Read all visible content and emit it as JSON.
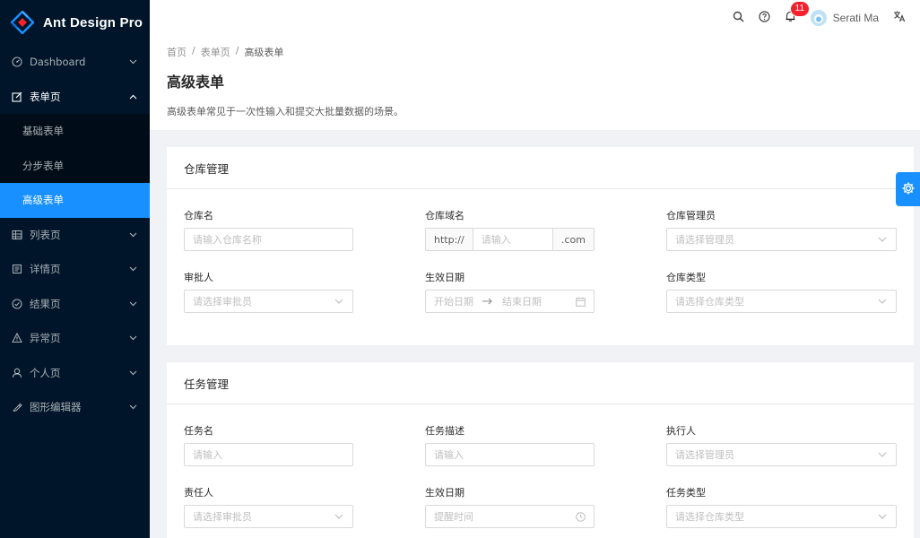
{
  "app": {
    "name": "Ant Design Pro"
  },
  "sidebar": {
    "items": [
      {
        "label": "Dashboard",
        "icon": "dashboard-icon"
      },
      {
        "label": "表单页",
        "icon": "form-icon",
        "open": true,
        "children": [
          {
            "label": "基础表单"
          },
          {
            "label": "分步表单"
          },
          {
            "label": "高级表单",
            "selected": true
          }
        ]
      },
      {
        "label": "列表页",
        "icon": "table-icon"
      },
      {
        "label": "详情页",
        "icon": "profile-icon"
      },
      {
        "label": "结果页",
        "icon": "check-circle-icon"
      },
      {
        "label": "异常页",
        "icon": "warning-icon"
      },
      {
        "label": "个人页",
        "icon": "user-icon"
      },
      {
        "label": "图形编辑器",
        "icon": "highlight-icon"
      }
    ]
  },
  "header": {
    "notification_count": "11",
    "user_name": "Serati Ma"
  },
  "page": {
    "breadcrumb": [
      "首页",
      "表单页",
      "高级表单"
    ],
    "title": "高级表单",
    "description": "高级表单常见于一次性输入和提交大批量数据的场景。"
  },
  "warehouse_card": {
    "title": "仓库管理",
    "name": {
      "label": "仓库名",
      "placeholder": "请输入仓库名称"
    },
    "domain": {
      "label": "仓库域名",
      "prefix": "http://",
      "placeholder": "请输入",
      "suffix": ".com"
    },
    "admin": {
      "label": "仓库管理员",
      "placeholder": "请选择管理员"
    },
    "approver": {
      "label": "审批人",
      "placeholder": "请选择审批员"
    },
    "date": {
      "label": "生效日期",
      "start_placeholder": "开始日期",
      "end_placeholder": "结束日期"
    },
    "type": {
      "label": "仓库类型",
      "placeholder": "请选择仓库类型"
    }
  },
  "task_card": {
    "title": "任务管理",
    "name": {
      "label": "任务名",
      "placeholder": "请输入"
    },
    "desc": {
      "label": "任务描述",
      "placeholder": "请输入"
    },
    "executor": {
      "label": "执行人",
      "placeholder": "请选择管理员"
    },
    "owner": {
      "label": "责任人",
      "placeholder": "请选择审批员"
    },
    "date": {
      "label": "生效日期",
      "placeholder": "提醒时间"
    },
    "type": {
      "label": "任务类型",
      "placeholder": "请选择仓库类型"
    }
  },
  "colors": {
    "sider_bg": "#001529",
    "submenu_bg": "#000c17",
    "primary": "#1890ff",
    "badge": "#f5222d"
  }
}
